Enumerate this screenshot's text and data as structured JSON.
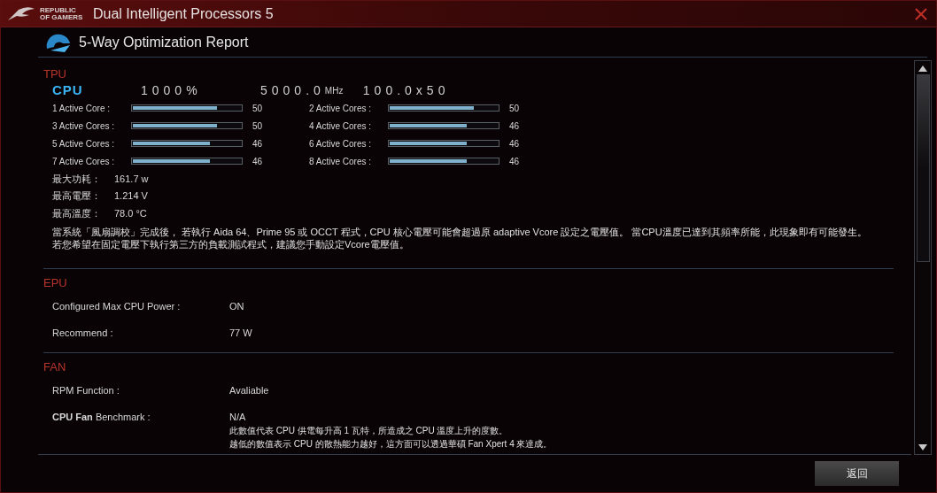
{
  "window": {
    "title": "Dual Intelligent Processors 5",
    "logo_text": "REPUBLIC OF GAMERS"
  },
  "report": {
    "title": "5-Way Optimization Report"
  },
  "tpu": {
    "heading": "TPU",
    "cpu_label": "CPU",
    "ratio": "1000%",
    "frequency": "5000.0",
    "frequency_unit": "MHz",
    "multiplier": "100.0x50",
    "cores": [
      {
        "label": "1 Active Core :",
        "level": 0.78,
        "value": "50"
      },
      {
        "label": "2 Active Cores :",
        "level": 0.78,
        "value": "50"
      },
      {
        "label": "3 Active Cores :",
        "level": 0.78,
        "value": "50"
      },
      {
        "label": "4 Active Cores :",
        "level": 0.71,
        "value": "46"
      },
      {
        "label": "5 Active Cores :",
        "level": 0.71,
        "value": "46"
      },
      {
        "label": "6 Active Cores :",
        "level": 0.71,
        "value": "46"
      },
      {
        "label": "7 Active Cores :",
        "level": 0.71,
        "value": "46"
      },
      {
        "label": "8 Active Cores :",
        "level": 0.71,
        "value": "46"
      }
    ],
    "metrics": [
      {
        "label": "最大功耗：",
        "value": "161.7 w"
      },
      {
        "label": "最高電壓：",
        "value": "1.214 V"
      },
      {
        "label": "最高溫度：",
        "value": "78.0 °C"
      }
    ],
    "note": "當系統「風扇調校」完成後， 若執行 Aida 64、Prime 95 或  OCCT 程式，CPU 核心電壓可能會超過原 adaptive Vcore 設定之電壓值。 當CPU溫度已達到其頻率所能，此現象即有可能發生。若您希望在固定電壓下執行第三方的負載測試程式，建議您手動設定Vcore電壓值。"
  },
  "epu": {
    "heading": "EPU",
    "rows": [
      {
        "label": "Configured Max CPU Power :",
        "value": "ON"
      },
      {
        "label": "Recommend :",
        "value": "77 W"
      }
    ]
  },
  "fan": {
    "heading": "FAN",
    "rows": [
      {
        "label": "RPM Function :",
        "value": "Avaliable"
      },
      {
        "label": "**CPU Fan** Benchmark :",
        "value": "N/A"
      }
    ],
    "notes": [
      "此數值代表 CPU 供電每升高 1 瓦特，所造成之 CPU 溫度上升的度數。",
      "越低的數值表示 CPU 的散熱能力越好，這方面可以透過華碩 Fan Xpert 4 來達成。"
    ]
  },
  "buttons": [
    {
      "label": "返回"
    }
  ]
}
